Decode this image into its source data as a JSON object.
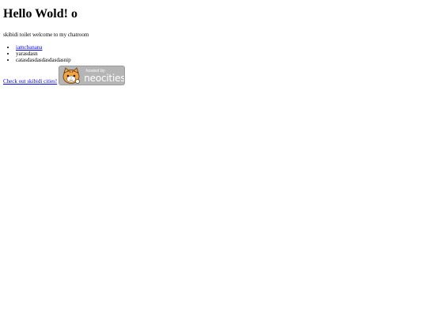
{
  "heading": "Hello Wold! o",
  "intro": "skibidi toilet welcome to my chatroom",
  "list": {
    "items": [
      {
        "label": "iamcbanana",
        "link": true
      },
      {
        "label": "yarasdasn",
        "link": false
      },
      {
        "label": "catasdasdasdasdasdasnip",
        "link": false
      }
    ]
  },
  "footer": {
    "link_label": "Check out skibidi cities!",
    "badge_small": "hosted by",
    "badge_big": "neocities"
  }
}
